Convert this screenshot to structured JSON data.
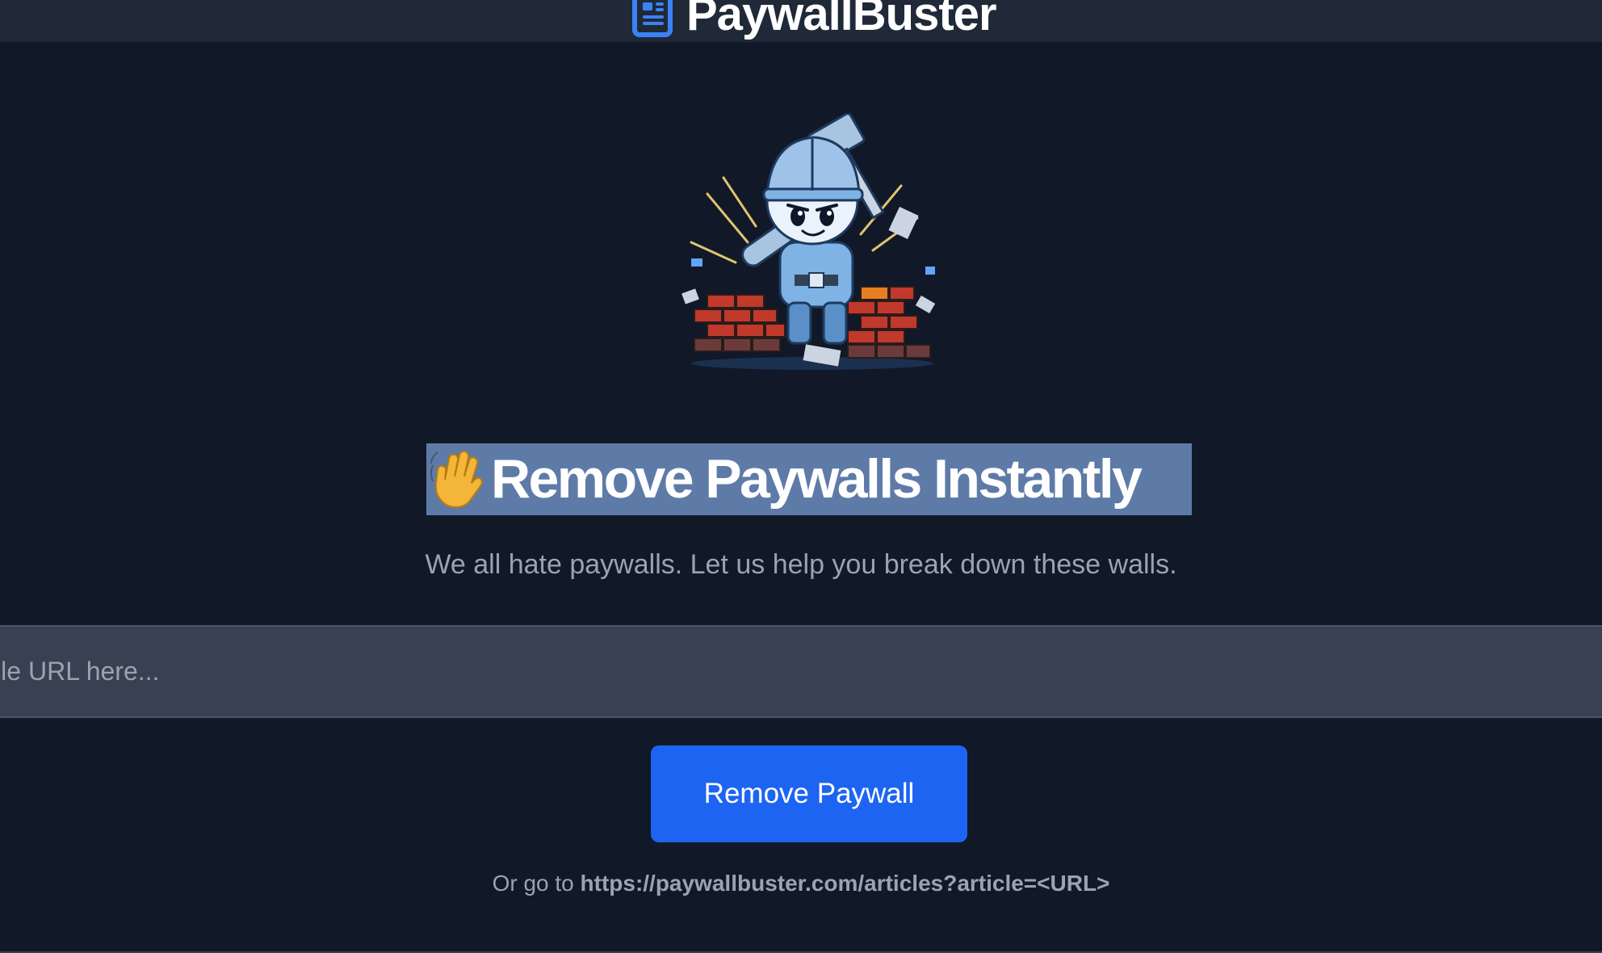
{
  "header": {
    "brand_name": "PaywallBuster",
    "brand_icon": "newspaper-icon"
  },
  "hero": {
    "illustration": "wall-breaker-mascot-illustration"
  },
  "headline": {
    "emoji": "👋",
    "emoji_icon": "waving-hand-icon",
    "text": "Remove Paywalls Instantly"
  },
  "subtitle": "We all hate paywalls. Let us help you break down these walls.",
  "url_input": {
    "placeholder": "Paste article URL here...",
    "value": ""
  },
  "actions": {
    "remove_button_label": "Remove Paywall"
  },
  "alt_route": {
    "prefix": "Or go to ",
    "url": "https://paywallbuster.com/articles?article=<URL>"
  },
  "colors": {
    "page_bg": "#111827",
    "header_bg": "#1f2937",
    "input_bg": "#374151",
    "accent": "#1d64f2",
    "selection": "#5e7ba8",
    "brand_icon": "#3b82f6"
  }
}
